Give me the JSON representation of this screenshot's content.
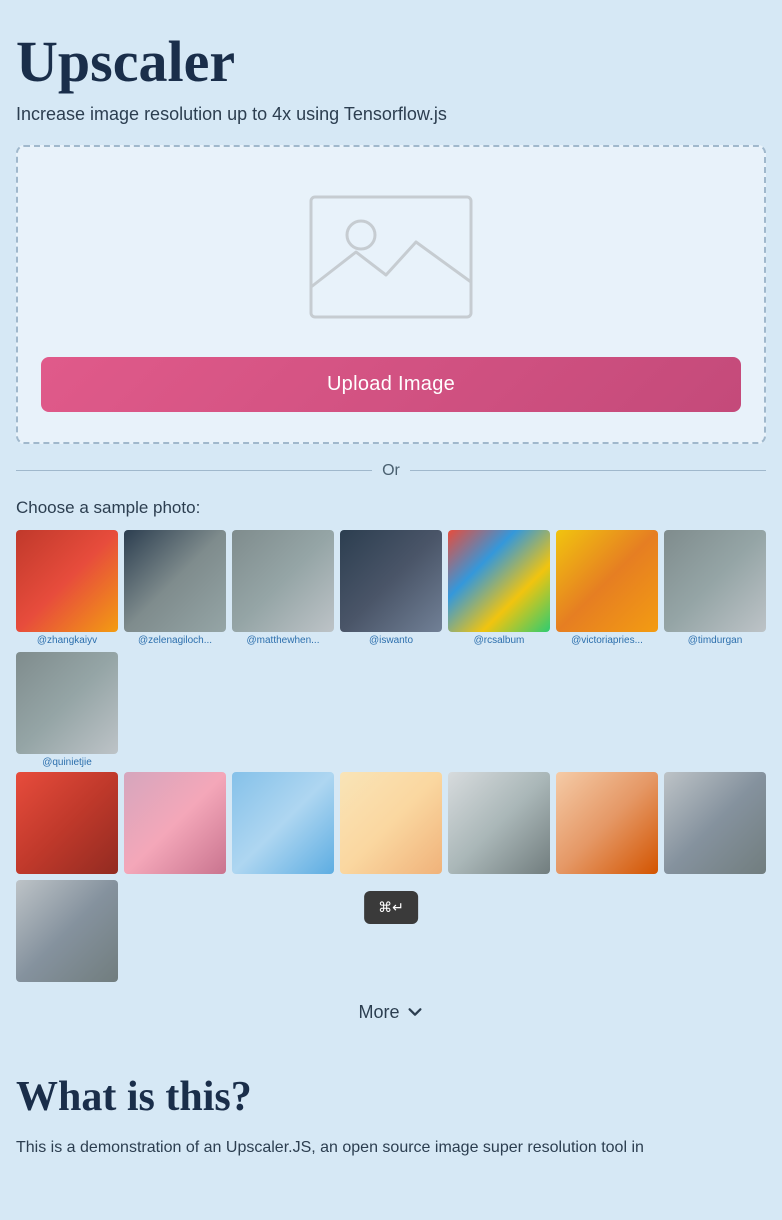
{
  "app": {
    "title": "Upscaler",
    "subtitle": "Increase image resolution up to 4x using Tensorflow.js"
  },
  "upload": {
    "button_label": "Upload Image",
    "placeholder_icon": "image-placeholder-icon"
  },
  "divider": {
    "text": "Or"
  },
  "samples": {
    "label": "Choose a sample photo:",
    "row1": [
      {
        "credit": "@zhangkaiyv",
        "color_class": "thumb-red"
      },
      {
        "credit": "@zelenagiloch...",
        "color_class": "thumb-bird"
      },
      {
        "credit": "@matthewhen...",
        "color_class": "thumb-street"
      },
      {
        "credit": "@iswanto",
        "color_class": "thumb-elephant"
      },
      {
        "credit": "@rcsalbum",
        "color_class": "thumb-flowers"
      },
      {
        "credit": "@victoriapries...",
        "color_class": "thumb-yellow"
      },
      {
        "credit": "@timdurgan",
        "color_class": "thumb-fashion"
      },
      {
        "credit": "@quinietjie",
        "color_class": "thumb-fashion"
      }
    ],
    "row2": [
      {
        "color_class": "thumb-r2-0"
      },
      {
        "color_class": "thumb-r2-1"
      },
      {
        "color_class": "thumb-r2-2"
      },
      {
        "color_class": "thumb-r2-3"
      },
      {
        "color_class": "thumb-r2-4"
      },
      {
        "color_class": "thumb-r2-5"
      },
      {
        "color_class": "thumb-r2-6"
      },
      {
        "color_class": "thumb-r2-6"
      }
    ],
    "more_label": "More"
  },
  "what_section": {
    "title": "What is this?",
    "description": "This is a demonstration of an Upscaler.JS, an open source image super resolution tool in"
  },
  "keyboard": {
    "shortcut": "⌘↵"
  }
}
